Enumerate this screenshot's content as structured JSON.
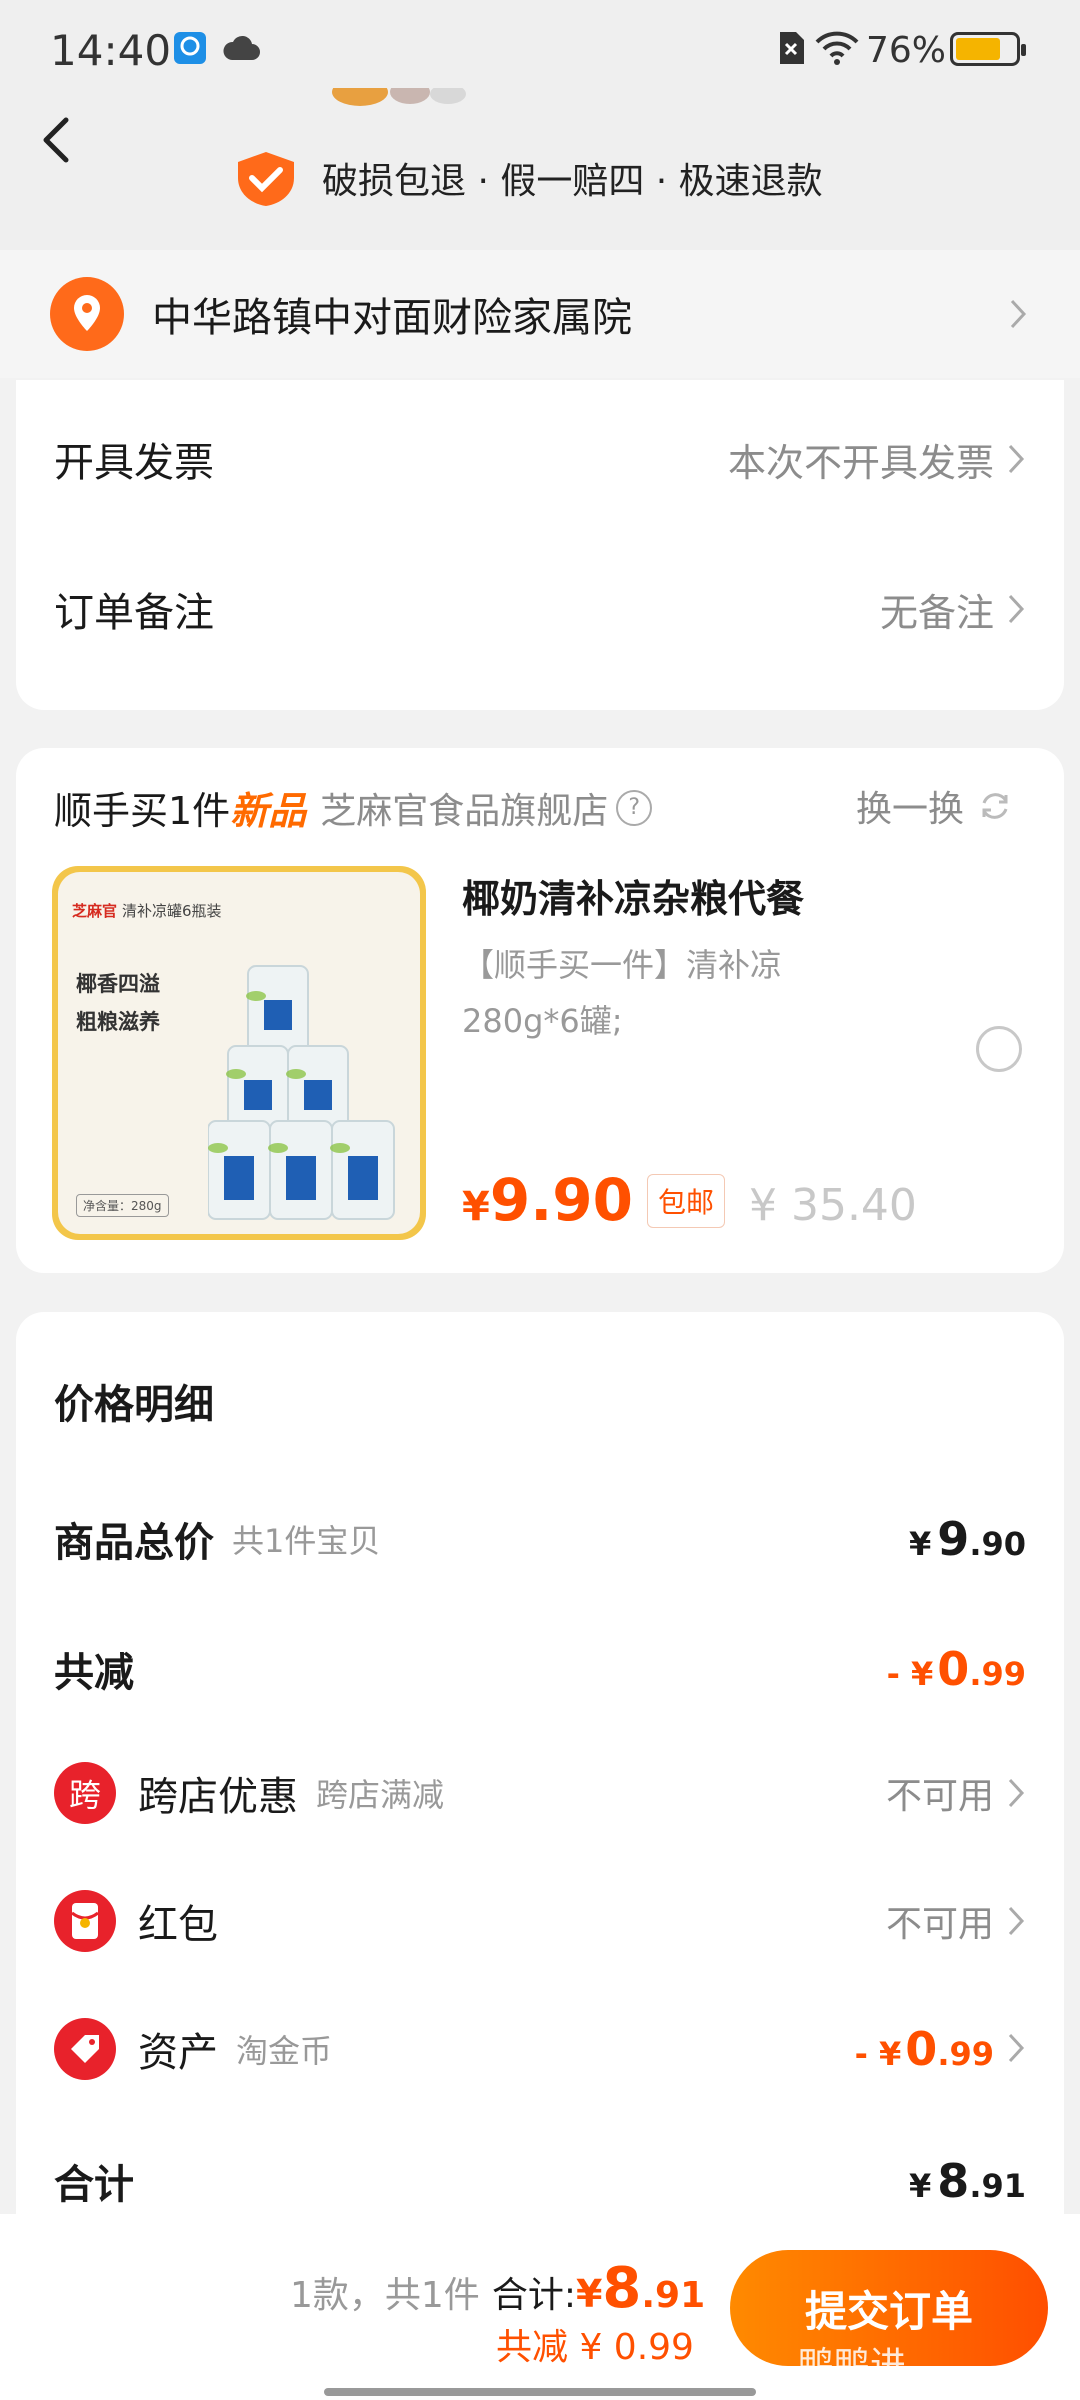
{
  "status": {
    "time": "14:40",
    "battery": "76%",
    "battery_level": 0.76
  },
  "header": {
    "guarantee": "破损包退 · 假一赔四 · 极速退款"
  },
  "address": {
    "text": "中华路镇中对面财险家属院"
  },
  "invoice": {
    "label": "开具发票",
    "value": "本次不开具发票"
  },
  "remark": {
    "label": "订单备注",
    "value": "无备注"
  },
  "addon": {
    "title": "顺手买1件",
    "new_tag": "新品",
    "store": "芝麻官食品旗舰店",
    "swap": "换一换",
    "product": {
      "name": "椰奶清补凉杂粮代餐",
      "desc": "【顺手买一件】清补凉",
      "spec": "280g*6罐;",
      "price_symbol": "¥",
      "price": "9.90",
      "free_ship": "包邮",
      "orig_price": "¥ 35.40",
      "img_brand": "芝麻官",
      "img_title": "清补凉罐6瓶装",
      "img_slogan1": "椰香四溢",
      "img_slogan2": "粗粮滋养",
      "img_net": "净含量：280g"
    }
  },
  "price_detail": {
    "title": "价格明细",
    "goods_total_label": "商品总价",
    "goods_total_sub": "共1件宝贝",
    "goods_total_sym": "¥",
    "goods_total_int": "9",
    "goods_total_dec": ".90",
    "discount_label": "共减",
    "discount_prefix": "- ¥",
    "discount_int": "0",
    "discount_dec": ".99",
    "cross_badge": "跨",
    "cross_label": "跨店优惠",
    "cross_sub": "跨店满减",
    "cross_value": "不可用",
    "redpack_label": "红包",
    "redpack_value": "不可用",
    "asset_label": "资产",
    "asset_sub": "淘金币",
    "asset_prefix": "- ¥",
    "asset_int": "0",
    "asset_dec": ".99",
    "sum_label": "合计",
    "sum_sym": "¥",
    "sum_int": "8",
    "sum_dec": ".91"
  },
  "bottom": {
    "count": "1款，共1件",
    "total_label": "合计:",
    "total_sym": "¥",
    "total_int": "8",
    "total_dec": ".91",
    "saved": "共减 ¥ 0.99",
    "submit": "提交订单",
    "watermark": "鸭鸭进"
  },
  "colors": {
    "accent": "#ff5000",
    "submit_start": "#ff8a00",
    "submit_end": "#ff4f00"
  }
}
